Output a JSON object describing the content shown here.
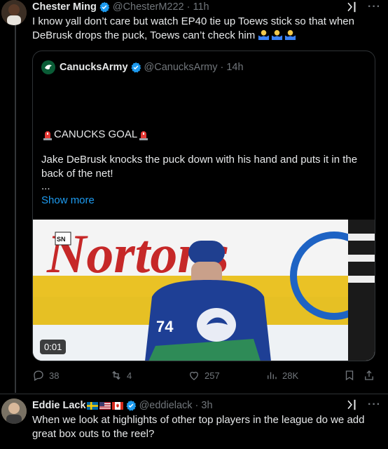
{
  "tweet1": {
    "name": "Chester Ming",
    "handle": "@ChesterM222",
    "time": "11h",
    "text": "I know yall don’t care but watch EP40 tie up Toews stick so that when DeBrusk drops the puck, Toews can’t check him"
  },
  "quote": {
    "name": "CanucksArmy",
    "handle": "@CanucksArmy",
    "time": "14h",
    "headline": "CANUCKS GOAL",
    "body": "Jake DeBrusk knocks the puck down with his hand and puts it in the back of the net!",
    "ellipsis": "...",
    "show_more": "Show more",
    "video_time": "0:01",
    "video_logo": "SN",
    "ad_text": "Nortons",
    "jersey_number": "74"
  },
  "actions": {
    "replies": "38",
    "reposts": "4",
    "likes": "257",
    "views": "28K"
  },
  "tweet2": {
    "name": "Eddie Lack",
    "handle": "@eddielack",
    "time": "3h",
    "text": "When we look at highlights of other top players in the league do we add great box outs to the reel?"
  },
  "ui": {
    "dot": "·",
    "more": "···"
  },
  "colors": {
    "background": "#000000",
    "text": "#e7e9ea",
    "muted": "#71767b",
    "link": "#1d9bf0",
    "border": "#2f3336",
    "verified": "#1d9bf0"
  }
}
